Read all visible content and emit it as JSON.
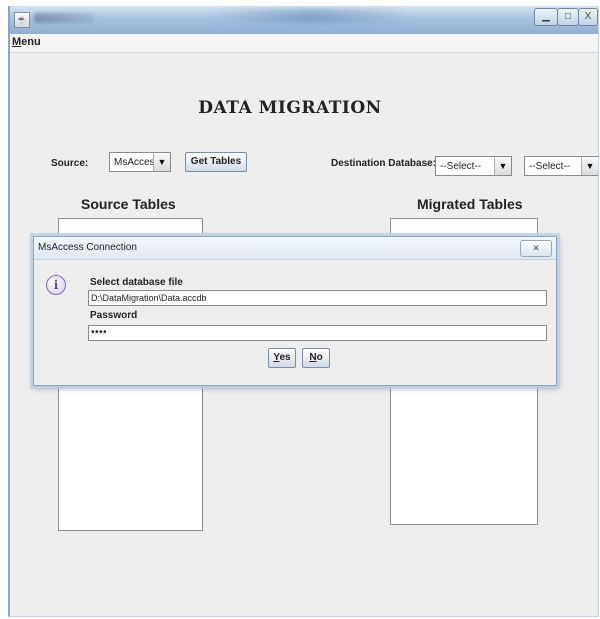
{
  "window": {
    "app_icon": "java-app-icon",
    "controls": {
      "minimize_icon": "minimize-icon",
      "maximize_icon": "maximize-icon",
      "close_icon": "close-icon"
    }
  },
  "menubar": {
    "menu_mnemonic": "M",
    "menu_rest": "enu"
  },
  "main": {
    "title": "DATA MIGRATION",
    "source_label": "Source:",
    "source_value": "MsAccess",
    "get_tables_label": "Get Tables",
    "destination_label": "Destination Database:",
    "destination_select_1": "--Select--",
    "destination_select_2": "--Select--",
    "source_tables_title": "Source Tables",
    "migrated_tables_title": "Migrated Tables"
  },
  "dialog": {
    "title": "MsAccess Connection",
    "info_icon_glyph": "i",
    "file_label": "Select database file",
    "file_value": "D:\\DataMigration\\Data.accdb",
    "password_label": "Password",
    "password_value": "••••",
    "yes_mnemonic": "Y",
    "yes_rest": "es",
    "no_mnemonic": "N",
    "no_rest": "o"
  }
}
